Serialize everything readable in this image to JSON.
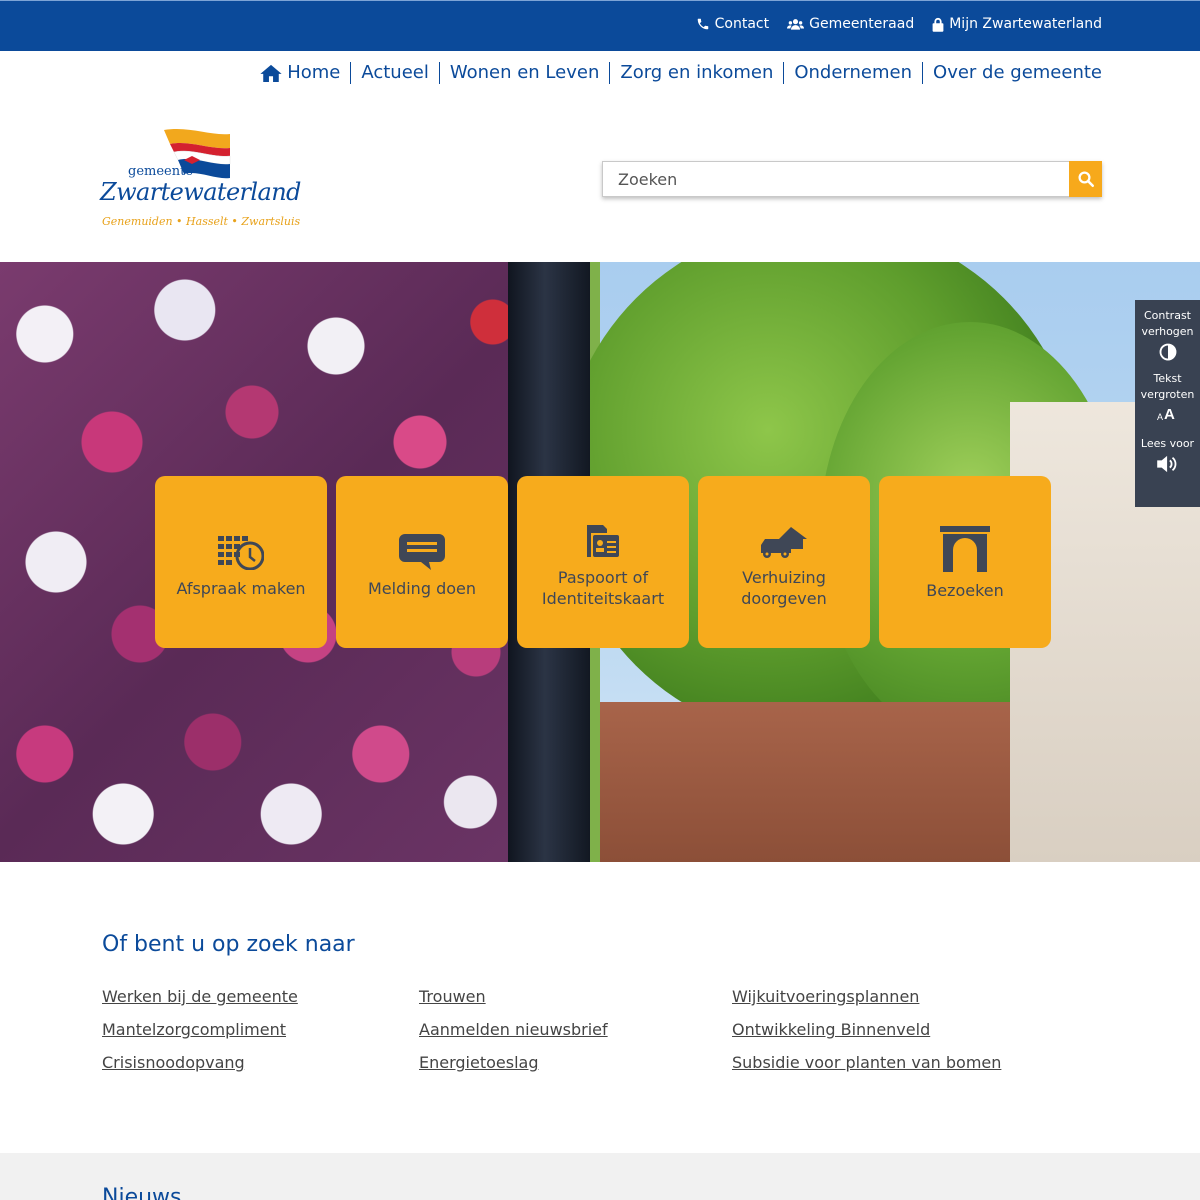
{
  "topbar": {
    "links": [
      {
        "label": "Contact",
        "icon": "phone-icon"
      },
      {
        "label": "Gemeenteraad",
        "icon": "users-icon"
      },
      {
        "label": "Mijn Zwartewaterland",
        "icon": "lock-icon"
      }
    ]
  },
  "nav": {
    "items": [
      {
        "label": "Home",
        "icon": "home-icon"
      },
      {
        "label": "Actueel"
      },
      {
        "label": "Wonen en Leven"
      },
      {
        "label": "Zorg en inkomen"
      },
      {
        "label": "Ondernemen"
      },
      {
        "label": "Over de gemeente"
      }
    ]
  },
  "logo": {
    "prefix": "gemeente",
    "name": "Zwartewaterland",
    "places": "Genemuiden • Hasselt • Zwartsluis"
  },
  "search": {
    "placeholder": "Zoeken",
    "icon": "search-icon"
  },
  "tiles": [
    {
      "label": "Afspraak maken",
      "icon": "calendar-clock-icon"
    },
    {
      "label": "Melding doen",
      "icon": "chat-bubble-icon"
    },
    {
      "label": "Paspoort of Identiteitskaart",
      "icon": "id-card-icon"
    },
    {
      "label": "Verhuizing doorgeven",
      "icon": "moving-truck-icon"
    },
    {
      "label": "Bezoeken",
      "icon": "gate-icon"
    }
  ],
  "accessibility": {
    "contrast": "Contrast verhogen",
    "text_size": "Tekst vergroten",
    "read_aloud": "Lees voor"
  },
  "zoek": {
    "title": "Of bent u op zoek naar",
    "columns": [
      [
        "Werken bij de gemeente",
        "Mantelzorgcompliment",
        "Crisisnoodopvang"
      ],
      [
        "Trouwen",
        "Aanmelden nieuwsbrief",
        "Energietoeslag"
      ],
      [
        "Wijkuitvoeringsplannen",
        "Ontwikkeling Binnenveld",
        "Subsidie voor planten van bomen"
      ]
    ]
  },
  "news": {
    "title": "Nieuws"
  },
  "colors": {
    "brand_blue": "#0b4a9a",
    "accent_orange": "#f7ab1c",
    "panel_dark": "#394252"
  }
}
